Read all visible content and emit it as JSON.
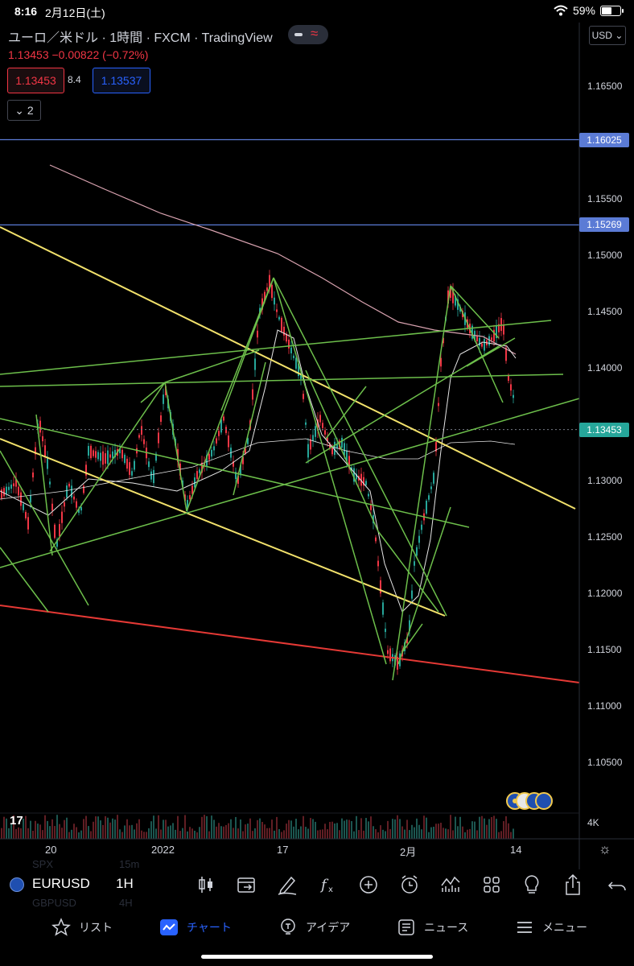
{
  "status_bar": {
    "time": "8:16",
    "date": "2月12日(土)",
    "battery": "59%",
    "battery_level": 0.59
  },
  "chart": {
    "title": "ユーロ／米ドル · 1時間 · FXCM · TradingView",
    "last": "1.13453",
    "change": "−0.00822 (−0.72%)",
    "sell_price": "1.13453",
    "buy_price": "1.13537",
    "spread": "8.4",
    "indicator_count": "2",
    "currency": "USD",
    "price_axis": [
      {
        "label": "1.16500",
        "v": 1.165
      },
      {
        "label": "1.15500",
        "v": 1.155
      },
      {
        "label": "1.15000",
        "v": 1.15
      },
      {
        "label": "1.14500",
        "v": 1.145
      },
      {
        "label": "1.14000",
        "v": 1.14
      },
      {
        "label": "1.13000",
        "v": 1.13
      },
      {
        "label": "1.12500",
        "v": 1.125
      },
      {
        "label": "1.12000",
        "v": 1.12
      },
      {
        "label": "1.11500",
        "v": 1.115
      },
      {
        "label": "1.11000",
        "v": 1.11
      },
      {
        "label": "1.10500",
        "v": 1.105
      }
    ],
    "levels": [
      {
        "label": "1.16025",
        "v": 1.16025,
        "color": "#5b7bd5"
      },
      {
        "label": "1.15269",
        "v": 1.15269,
        "color": "#5b7bd5"
      }
    ],
    "last_tag": {
      "label": "1.13453",
      "v": 1.13453,
      "color": "#26a69a"
    },
    "time_axis": [
      {
        "label": "20"
      },
      {
        "label": "2022"
      },
      {
        "label": "17"
      },
      {
        "label": "2月"
      },
      {
        "label": "14"
      }
    ],
    "volume_label": "4K",
    "colors": {
      "drawn_lines": "#6dbf4b",
      "trend_yellow": "#f2e16b",
      "trend_red": "#e53935",
      "ma_pink": "#d9a3b0",
      "ma_white": "#e6e6e6",
      "up": "#26a69a",
      "down": "#f23645"
    }
  },
  "toolbar": {
    "symbol": "EURUSD",
    "interval": "1H",
    "ghost_prev_symbol": "SPX",
    "ghost_next_symbol": "GBPUSD",
    "ghost_prev_interval": "15m",
    "ghost_next_interval": "4H",
    "icons": [
      "candles-icon",
      "replay-icon",
      "draw-icon",
      "function-icon",
      "add-icon",
      "alarm-icon",
      "compare-icon",
      "layout-icon",
      "idea-icon",
      "share-icon",
      "undo-icon"
    ]
  },
  "tabs": [
    {
      "label": "リスト",
      "icon": "star-icon"
    },
    {
      "label": "チャート",
      "icon": "chart-icon",
      "active": true
    },
    {
      "label": "アイデア",
      "icon": "idea-icon"
    },
    {
      "label": "ニュース",
      "icon": "news-icon"
    },
    {
      "label": "メニュー",
      "icon": "menu-icon"
    }
  ]
}
